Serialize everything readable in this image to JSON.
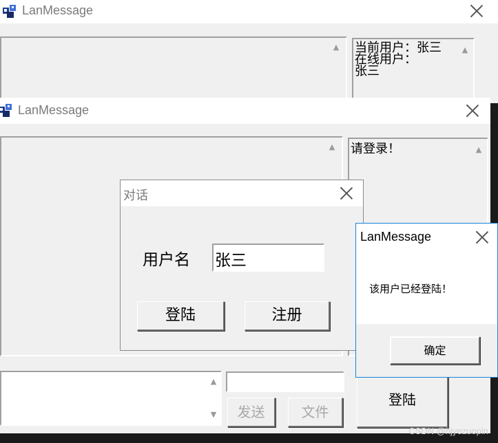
{
  "back_window": {
    "title": "LanMessage",
    "user_panel_lines": [
      "当前用户：张三",
      "在线用户：",
      "张三"
    ]
  },
  "main_window": {
    "title": "LanMessage",
    "status_text": "请登录！",
    "send_button": "发送",
    "file_button": "文件",
    "login_button": "登陆"
  },
  "login_dialog": {
    "title": "对话",
    "username_label": "用户名",
    "username_value": "张三",
    "login_button": "登陆",
    "register_button": "注册"
  },
  "message_box": {
    "title": "LanMessage",
    "message": "该用户已经登陆！",
    "ok_button": "确定"
  },
  "watermark": "CSDN @hjyezuopin"
}
